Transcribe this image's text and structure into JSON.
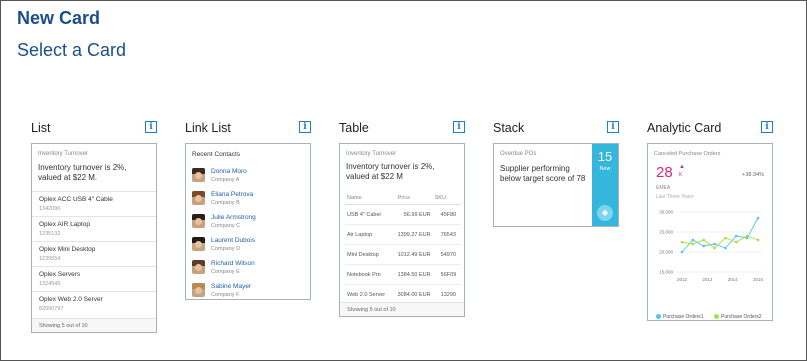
{
  "page": {
    "title": "New Card",
    "subtitle": "Select a Card",
    "info_glyph": "i"
  },
  "columns": [
    {
      "label": "List"
    },
    {
      "label": "Link List"
    },
    {
      "label": "Table"
    },
    {
      "label": "Stack"
    },
    {
      "label": "Analytic Card"
    }
  ],
  "list_card": {
    "header": "Inventory Turnover",
    "message": "Inventory turnover is 2%, valued at $22 M.",
    "items": [
      {
        "name": "Oplex ACC USB 4\" Cable",
        "sub": "1342096"
      },
      {
        "name": "Oplex AIR Laptop",
        "sub": "1235132"
      },
      {
        "name": "Oplex Mini Desktop",
        "sub": "1239554"
      },
      {
        "name": "Oplex Servers",
        "sub": "1324545"
      },
      {
        "name": "Oplex Web 2.0 Server",
        "sub": "82090797"
      }
    ],
    "footer": "Showing 5 out of 10"
  },
  "link_list": {
    "header": "Recent Contacts",
    "people": [
      {
        "name": "Donna Moro",
        "company": "Company A"
      },
      {
        "name": "Eliana Petrova",
        "company": "Company B"
      },
      {
        "name": "Julie Armstrong",
        "company": "Company C"
      },
      {
        "name": "Laurent Dubois",
        "company": "Company D"
      },
      {
        "name": "Richard Wilson",
        "company": "Company E"
      },
      {
        "name": "Sabine Mayer",
        "company": "Company F"
      }
    ]
  },
  "table_card": {
    "header": "Inventory Turnover",
    "message": "Inventory turnover is 2%, valued at $22 M",
    "columns": [
      "Name",
      "Price",
      "SKU"
    ],
    "rows": [
      [
        "USB 4\" Cabel",
        "56.99 EUR",
        "45F80"
      ],
      [
        "Air Laptop",
        "1399.27 EUR",
        "76543"
      ],
      [
        "Mini Desktop",
        "1012.49 EUR",
        "54970"
      ],
      [
        "Notebook Pro",
        "1384.50 EUR",
        "56F09"
      ],
      [
        "Web 2.0 Server",
        "3084.00 EUR",
        "13290"
      ]
    ],
    "footer": "Showing 5 out of 10"
  },
  "stack_card": {
    "header": "Overdue POs",
    "message": "Supplier performing below target score of 78",
    "count": "15",
    "count_label": "New"
  },
  "analytic_card": {
    "header": "Canceled Purchase Orders",
    "kpi": "28",
    "kpi_unit": "K",
    "kpi_arrow": "▲",
    "delta": "+38.34%",
    "sub1": "EMEA",
    "sub2": "Last Three Years"
  },
  "colors": {
    "title": "#1a4f8a",
    "info": "#1f7fc4",
    "stack_accent": "#35b6dd",
    "kpi": "#d42a7a",
    "series1": "#4fc6ea",
    "series2": "#a8e03b"
  },
  "chart_data": {
    "type": "line",
    "x": [
      "2012",
      "2013",
      "2014",
      "2015"
    ],
    "yticks": [
      "30,000",
      "25,000",
      "20,000",
      "15,000"
    ],
    "ylim": [
      15000,
      30000
    ],
    "series": [
      {
        "name": "Purchase Orders1",
        "values": [
          20000,
          23000,
          21500,
          22000,
          21000,
          24000,
          23500,
          28500
        ]
      },
      {
        "name": "Purchase Orders2",
        "values": [
          22500,
          22000,
          23000,
          21000,
          23500,
          22500,
          24000,
          23000
        ]
      }
    ]
  }
}
